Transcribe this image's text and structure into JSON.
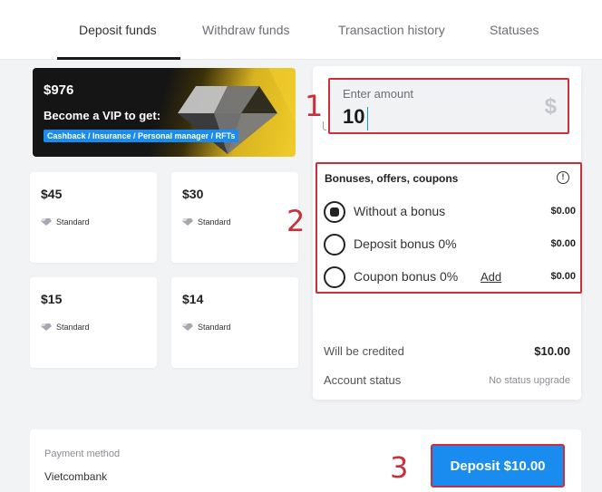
{
  "tabs": [
    {
      "label": "Deposit funds",
      "active": true
    },
    {
      "label": "Withdraw funds"
    },
    {
      "label": "Transaction history"
    },
    {
      "label": "Statuses"
    }
  ],
  "vip_banner": {
    "amount": "$976",
    "title": "Become a VIP to get:",
    "perks": "Cashback / Insurance / Personal manager / RFTs"
  },
  "amount_cards": [
    {
      "amount": "$45",
      "level": "Standard"
    },
    {
      "amount": "$30",
      "level": "Standard"
    },
    {
      "amount": "$15",
      "level": "Standard"
    },
    {
      "amount": "$14",
      "level": "Standard"
    }
  ],
  "amount_input": {
    "label": "Enter amount",
    "value": "10",
    "currency_icon": "dollar-icon"
  },
  "bonuses": {
    "title": "Bonuses, offers, coupons",
    "options": [
      {
        "label": "Without a bonus",
        "price": "$0.00",
        "checked": true
      },
      {
        "label": "Deposit bonus 0%",
        "price": "$0.00",
        "checked": false
      },
      {
        "label": "Coupon bonus 0%",
        "price": "$0.00",
        "checked": false,
        "link": "Add"
      }
    ]
  },
  "summary": {
    "credited_label": "Will be credited",
    "credited_value": "$10.00",
    "status_label": "Account status",
    "status_value": "No status upgrade"
  },
  "payment": {
    "label": "Payment method",
    "value": "Vietcombank"
  },
  "deposit_button": "Deposit $10.00",
  "step_markers": [
    "1",
    "2",
    "3"
  ],
  "colors": {
    "accent_blue": "#1a8cf0",
    "highlight_red": "#c8313b"
  }
}
